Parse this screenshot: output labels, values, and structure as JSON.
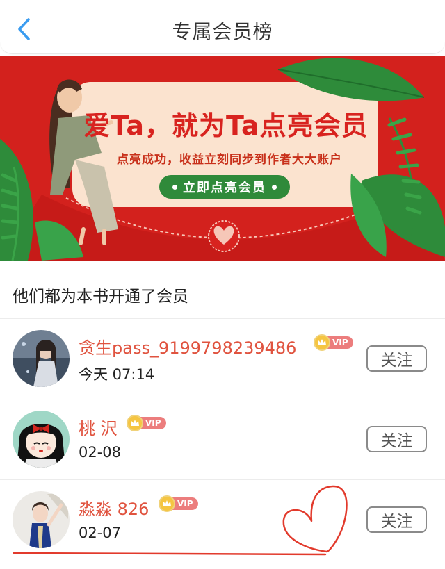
{
  "header": {
    "title": "专属会员榜",
    "back_icon": "chevron-left-icon"
  },
  "banner": {
    "headline": "爱Ta，就为Ta点亮会员",
    "subtitle": "点亮成功，收益立刻同步到作者大大账户",
    "cta_label": "立即点亮会员",
    "colors": {
      "background": "#d8231f",
      "card": "#fbe3cf",
      "leaf": "#2e8b3a",
      "cta": "#2f8a3a"
    }
  },
  "section": {
    "title": "他们都为本书开通了会员"
  },
  "members": [
    {
      "name": "贪生pass_9199798239486",
      "badge": "VIP",
      "time": "今天 07:14",
      "follow_label": "关注"
    },
    {
      "name": "桃 沢",
      "badge": "VIP",
      "time": "02-08",
      "follow_label": "关注"
    },
    {
      "name": "淼淼 826",
      "badge": "VIP",
      "time": "02-07",
      "follow_label": "关注"
    }
  ],
  "colors": {
    "accent_name": "#e0533f",
    "vip_tag": "#ec7d7d",
    "vip_crown": "#f5c542",
    "back_icon": "#3a9cf0"
  }
}
